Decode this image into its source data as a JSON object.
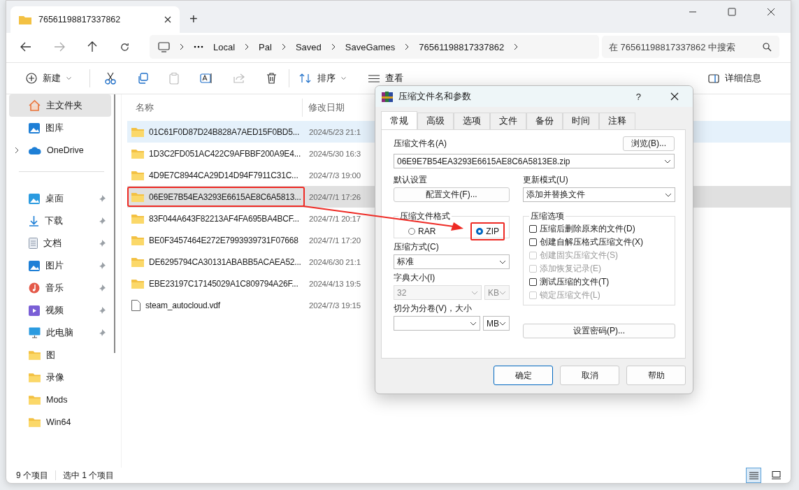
{
  "explorer": {
    "tab_title": "76561198817337862",
    "new_tab": "+",
    "breadcrumb": [
      "Local",
      "Pal",
      "Saved",
      "SaveGames",
      "76561198817337862"
    ],
    "search": {
      "placeholder": "在 76561198817337862 中搜索"
    },
    "toolbar": {
      "new": "新建",
      "sort": "排序",
      "view": "查看",
      "details": "详细信息"
    },
    "nav_sections": [
      {
        "items": [
          {
            "label": "主文件夹",
            "kind": "home",
            "selected": true,
            "pinned": false,
            "expandable": false
          },
          {
            "label": "图库",
            "kind": "gallery",
            "selected": false,
            "pinned": false,
            "expandable": false
          },
          {
            "label": "OneDrive",
            "kind": "cloud",
            "selected": false,
            "pinned": false,
            "expandable": true
          }
        ]
      },
      {
        "items": [
          {
            "label": "桌面",
            "kind": "desktop",
            "selected": false,
            "pinned": true,
            "expandable": false
          },
          {
            "label": "下载",
            "kind": "download",
            "selected": false,
            "pinned": true,
            "expandable": false
          },
          {
            "label": "文档",
            "kind": "document",
            "selected": false,
            "pinned": true,
            "expandable": false
          },
          {
            "label": "图片",
            "kind": "picture",
            "selected": false,
            "pinned": true,
            "expandable": false
          },
          {
            "label": "音乐",
            "kind": "music",
            "selected": false,
            "pinned": true,
            "expandable": false
          },
          {
            "label": "视频",
            "kind": "video",
            "selected": false,
            "pinned": true,
            "expandable": false
          },
          {
            "label": "此电脑",
            "kind": "computer",
            "selected": false,
            "pinned": true,
            "expandable": false
          },
          {
            "label": "图",
            "kind": "folder",
            "selected": false,
            "pinned": false,
            "expandable": false
          },
          {
            "label": "录像",
            "kind": "folder",
            "selected": false,
            "pinned": false,
            "expandable": false
          },
          {
            "label": "Mods",
            "kind": "folder",
            "selected": false,
            "pinned": false,
            "expandable": false
          },
          {
            "label": "Win64",
            "kind": "folder",
            "selected": false,
            "pinned": false,
            "expandable": false
          }
        ]
      }
    ],
    "columns": [
      "名称",
      "修改日期"
    ],
    "files": [
      {
        "name": "01C61F0D87D24B828A7AED15F0BD5...",
        "date": "2024/5/23 21:1",
        "kind": "folder",
        "selected": false,
        "hovered": true,
        "highlighted": false
      },
      {
        "name": "1D3C2FD051AC422C9AFBBF200A9E4...",
        "date": "2024/5/30 16:3",
        "kind": "folder",
        "selected": false,
        "hovered": false,
        "highlighted": false
      },
      {
        "name": "4D9E7C8944CA29D14D94F7911C31C...",
        "date": "2024/7/3 19:00",
        "kind": "folder",
        "selected": false,
        "hovered": false,
        "highlighted": false
      },
      {
        "name": "06E9E7B54EA3293E6615AE8C6A5813...",
        "date": "2024/7/1 17:26",
        "kind": "folder",
        "selected": true,
        "hovered": false,
        "highlighted": true
      },
      {
        "name": "83F044A643F82213AF4FA695BA4BCF...",
        "date": "2024/7/1 20:17",
        "kind": "folder",
        "selected": false,
        "hovered": false,
        "highlighted": false
      },
      {
        "name": "BE0F3457464E272E7993939731F07668",
        "date": "2024/7/1 17:20",
        "kind": "folder",
        "selected": false,
        "hovered": false,
        "highlighted": false
      },
      {
        "name": "DE6295794CA30131ABABB5ACAEA52...",
        "date": "2024/6/30 21:1",
        "kind": "folder",
        "selected": false,
        "hovered": false,
        "highlighted": false
      },
      {
        "name": "EBE23197C17145029A1C809794A26F...",
        "date": "2024/4/13 19:5",
        "kind": "folder",
        "selected": false,
        "hovered": false,
        "highlighted": false
      },
      {
        "name": "steam_autocloud.vdf",
        "date": "2024/7/3 19:15",
        "kind": "file",
        "selected": false,
        "hovered": false,
        "highlighted": false
      }
    ],
    "status": [
      "9 个项目",
      "选中 1 个项目"
    ],
    "view_modes": [
      {
        "kind": "details",
        "selected": true
      },
      {
        "kind": "tiles",
        "selected": false
      }
    ]
  },
  "dialog": {
    "title": "压缩文件名和参数",
    "help": "?",
    "tabs": [
      {
        "label": "常规",
        "selected": true
      },
      {
        "label": "高级",
        "selected": false
      },
      {
        "label": "选项",
        "selected": false
      },
      {
        "label": "文件",
        "selected": false
      },
      {
        "label": "备份",
        "selected": false
      },
      {
        "label": "时间",
        "selected": false
      },
      {
        "label": "注释",
        "selected": false
      }
    ],
    "archive_name_label": "压缩文件名(A)",
    "browse": "浏览(B)...",
    "archive_name": "06E9E7B54EA3293E6615AE8C6A5813E8.zip",
    "default_label": "默认设置",
    "profiles_button": "配置文件(F)...",
    "update_label": "更新模式(U)",
    "update_mode": "添加并替换文件",
    "format_label": "压缩文件格式",
    "formats": [
      {
        "label": "RAR",
        "selected": false,
        "highlighted": false
      },
      {
        "label": "ZIP",
        "selected": true,
        "highlighted": true
      }
    ],
    "method_label": "压缩方式(C)",
    "method": "标准",
    "dict_label": "字典大小(I)",
    "dict_size": {
      "value": "32",
      "disabled": true
    },
    "dict_unit": {
      "value": "KB",
      "disabled": true
    },
    "split_label": "切分为分卷(V)，大小",
    "split_unit": {
      "value": "MB",
      "disabled": false
    },
    "options_label": "压缩选项",
    "options": [
      {
        "label": "压缩后删除原来的文件(D)",
        "checked": false,
        "disabled": false
      },
      {
        "label": "创建自解压格式压缩文件(X)",
        "checked": false,
        "disabled": false
      },
      {
        "label": "创建固实压缩文件(S)",
        "checked": false,
        "disabled": true
      },
      {
        "label": "添加恢复记录(E)",
        "checked": false,
        "disabled": true
      },
      {
        "label": "测试压缩的文件(T)",
        "checked": false,
        "disabled": false
      },
      {
        "label": "锁定压缩文件(L)",
        "checked": false,
        "disabled": true
      }
    ],
    "password_button": "设置密码(P)...",
    "buttons": [
      {
        "label": "确定",
        "default": true
      },
      {
        "label": "取消",
        "default": false
      },
      {
        "label": "帮助",
        "default": false
      }
    ]
  }
}
